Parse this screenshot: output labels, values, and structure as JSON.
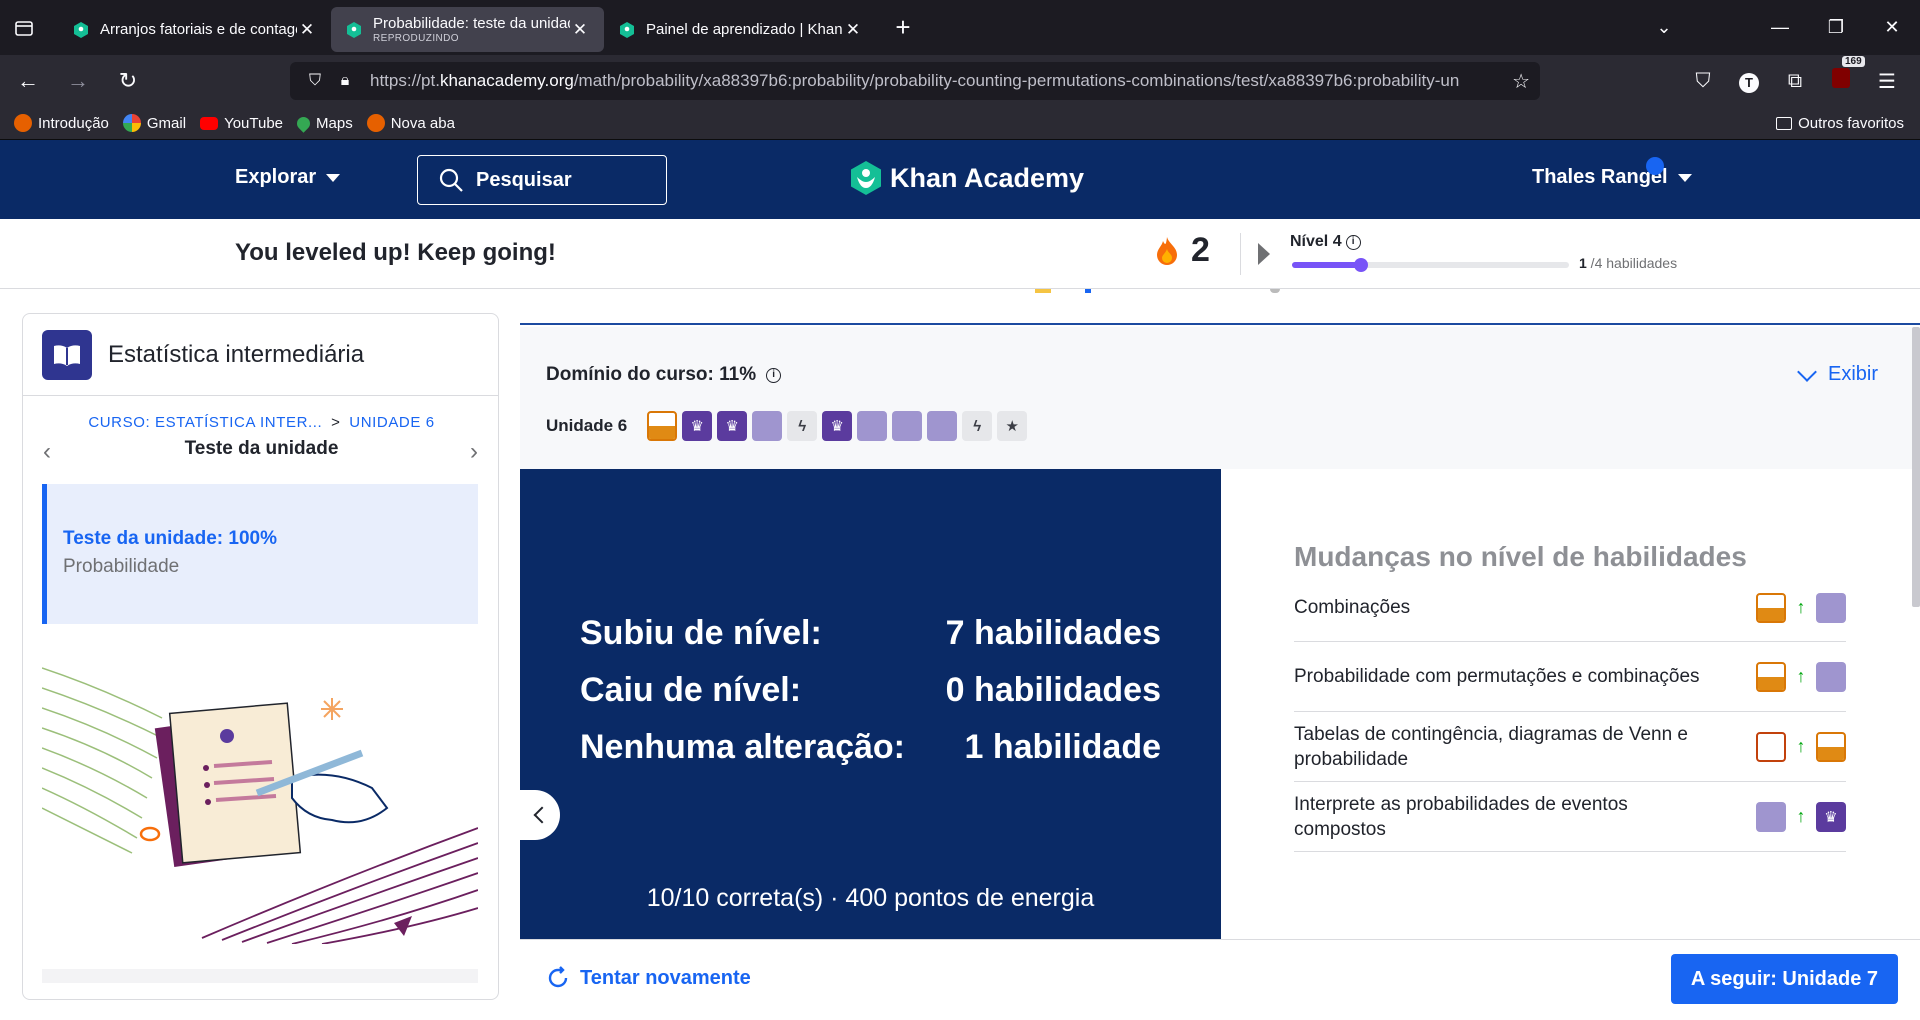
{
  "browser": {
    "tabs": [
      {
        "title": "Arranjos fatoriais e de contagem",
        "subtitle": "",
        "active": false
      },
      {
        "title": "Probabilidade: teste da unidade",
        "subtitle": "REPRODUZINDO",
        "active": true
      },
      {
        "title": "Painel de aprendizado | Khan Academy",
        "subtitle": "",
        "active": false
      }
    ],
    "url_prefix": "https://pt.",
    "url_domain": "khanacademy.org",
    "url_path": "/math/probability/xa88397b6:probability/probability-counting-permutations-combinations/test/xa88397b6:probability-un",
    "extension_badge": "169",
    "bookmarks": [
      "Introdução",
      "Gmail",
      "YouTube",
      "Maps",
      "Nova aba"
    ],
    "other_bookmarks": "Outros favoritos"
  },
  "header": {
    "explore": "Explorar",
    "search": "Pesquisar",
    "logo": "Khan Academy",
    "user": "Thales Rangel"
  },
  "levelbar": {
    "message": "You leveled up! Keep going!",
    "streak": "2",
    "level_title": "Nível 4",
    "progress_fraction": 0.25,
    "count_done": "1",
    "count_rest": " /4 habilidades"
  },
  "sidebar": {
    "course_name": "Estatística intermediária",
    "crumb_course": "CURSO: ESTATÍSTICA INTER...",
    "crumb_sep": ">",
    "crumb_unit": "UNIDADE 6",
    "unit_title": "Teste da unidade",
    "card_title": "Teste da unidade: 100%",
    "card_subtitle": "Probabilidade"
  },
  "mastery": {
    "title": "Domínio do curso: 11%",
    "toggle": "Exibir",
    "unit_label": "Unidade 6",
    "squares": [
      "familiar",
      "mastered",
      "mastered",
      "proficient",
      "quiz",
      "mastered",
      "proficient",
      "proficient",
      "proficient",
      "quiz",
      "test"
    ]
  },
  "results": {
    "rows": [
      {
        "label": "Subiu de nível:",
        "value": "7 habilidades"
      },
      {
        "label": "Caiu de nível:",
        "value": "0 habilidades"
      },
      {
        "label": "Nenhuma alteração:",
        "value": "1 habilidade"
      }
    ],
    "footer": "10/10 correta(s) · 400 pontos de energia"
  },
  "skills": {
    "title": "Mudanças no nível de habilidades",
    "items": [
      {
        "name": "Combinações",
        "from": "familiar",
        "to": "proficient"
      },
      {
        "name": "Probabilidade com permutações e combinações",
        "from": "familiar",
        "to": "proficient"
      },
      {
        "name": "Tabelas de contingência, diagramas de Venn e probabilidade",
        "from": "attempted",
        "to": "familiar"
      },
      {
        "name": "Interprete as probabilidades de eventos compostos",
        "from": "proficient",
        "to": "mastered"
      }
    ]
  },
  "actions": {
    "retry": "Tentar novamente",
    "next": "A seguir: Unidade 7"
  },
  "colors": {
    "brand_navy": "#0a2a66",
    "accent_blue": "#1865f2",
    "mastered": "#5b3b9e",
    "proficient": "#9f95cf",
    "familiar": "#e08a14"
  }
}
